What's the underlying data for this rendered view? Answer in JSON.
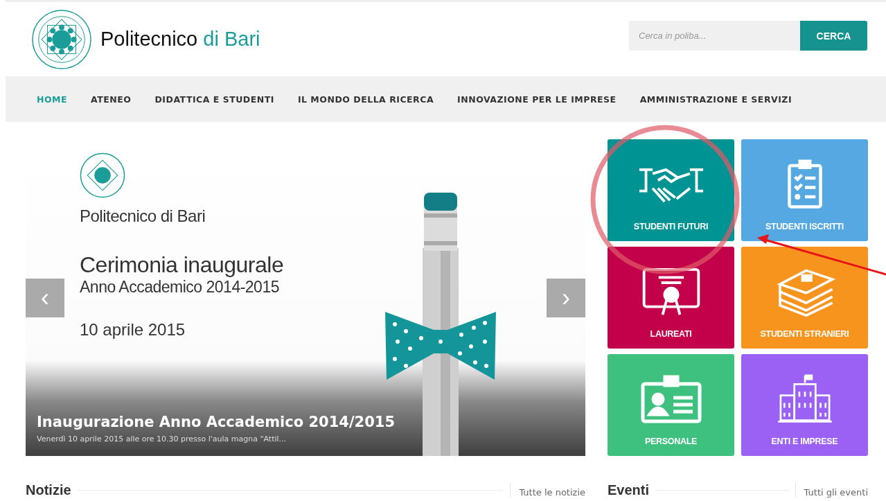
{
  "header": {
    "brand_name": "Politecnico",
    "brand_accent": "di Bari",
    "search": {
      "placeholder": "Cerca in poliba...",
      "button": "CERCA"
    }
  },
  "nav": [
    {
      "label": "HOME",
      "selected": true
    },
    {
      "label": "ATENEO",
      "selected": false
    },
    {
      "label": "DIDATTICA E STUDENTI",
      "selected": false
    },
    {
      "label": "IL MONDO DELLA RICERCA",
      "selected": false
    },
    {
      "label": "INNOVAZIONE PER LE IMPRESE",
      "selected": false
    },
    {
      "label": "AMMINISTRAZIONE E SERVIZI",
      "selected": false
    }
  ],
  "slider": {
    "prev": "‹",
    "next": "›",
    "slide": {
      "org": "Politecnico di Bari",
      "headline": "Cerimonia inaugurale",
      "subline": "Anno Accademico 2014-2015",
      "date": "10 aprile 2015"
    },
    "caption": {
      "title": "Inaugurazione Anno Accademico 2014/2015",
      "text": "Venerdì 10 aprile 2015 alle ore 10.30 presso l'aula magna \"Attil..."
    }
  },
  "tiles": [
    {
      "label": "STUDENTI FUTURI",
      "kind": "handshake",
      "color": "#009393"
    },
    {
      "label": "STUDENTI ISCRITTI",
      "kind": "clipboard",
      "color": "#55a8e2"
    },
    {
      "label": "LAUREATI",
      "kind": "diploma",
      "color": "#c3004a"
    },
    {
      "label": "STUDENTI STRANIERI",
      "kind": "books",
      "color": "#f7941d"
    },
    {
      "label": "PERSONALE",
      "kind": "badge",
      "color": "#3ec17f"
    },
    {
      "label": "ENTI E IMPRESE",
      "kind": "building",
      "color": "#9b61f5"
    }
  ],
  "sections": [
    {
      "title": "Notizie",
      "link": "Tutte le notizie"
    },
    {
      "title": "Eventi",
      "link": "Tutti gli eventi"
    }
  ]
}
